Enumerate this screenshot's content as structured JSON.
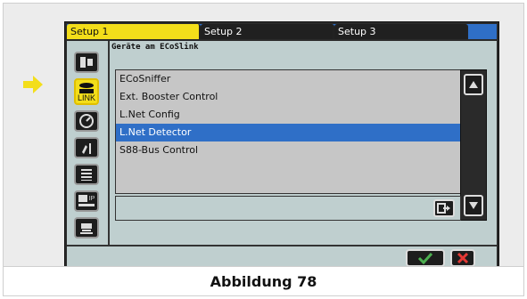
{
  "caption": "Abbildung 78",
  "tabs": [
    {
      "label": "Setup 1",
      "active": true
    },
    {
      "label": "Setup 2",
      "active": false
    },
    {
      "label": "Setup 3",
      "active": false
    }
  ],
  "main": {
    "title": "Geräte am ECoSlink",
    "list": [
      {
        "label": "ECoSniffer",
        "selected": false
      },
      {
        "label": "Ext. Booster Control",
        "selected": false
      },
      {
        "label": "L.Net Config",
        "selected": false
      },
      {
        "label": "L.Net Detector",
        "selected": true
      },
      {
        "label": "S88-Bus Control",
        "selected": false
      }
    ]
  },
  "sidebar": {
    "items": [
      {
        "name": "device-icon"
      },
      {
        "name": "link-icon",
        "label": "LINK",
        "active": true
      },
      {
        "name": "gauge-icon"
      },
      {
        "name": "tools-icon"
      },
      {
        "name": "list-icon"
      },
      {
        "name": "network-ip-icon",
        "label": "IP"
      },
      {
        "name": "loco-icon"
      }
    ]
  },
  "colors": {
    "tab_active": "#f3de1a",
    "selection": "#2f6fc7",
    "arrow": "#f3de1a",
    "ok": "#4caf50",
    "cancel": "#e53935"
  }
}
